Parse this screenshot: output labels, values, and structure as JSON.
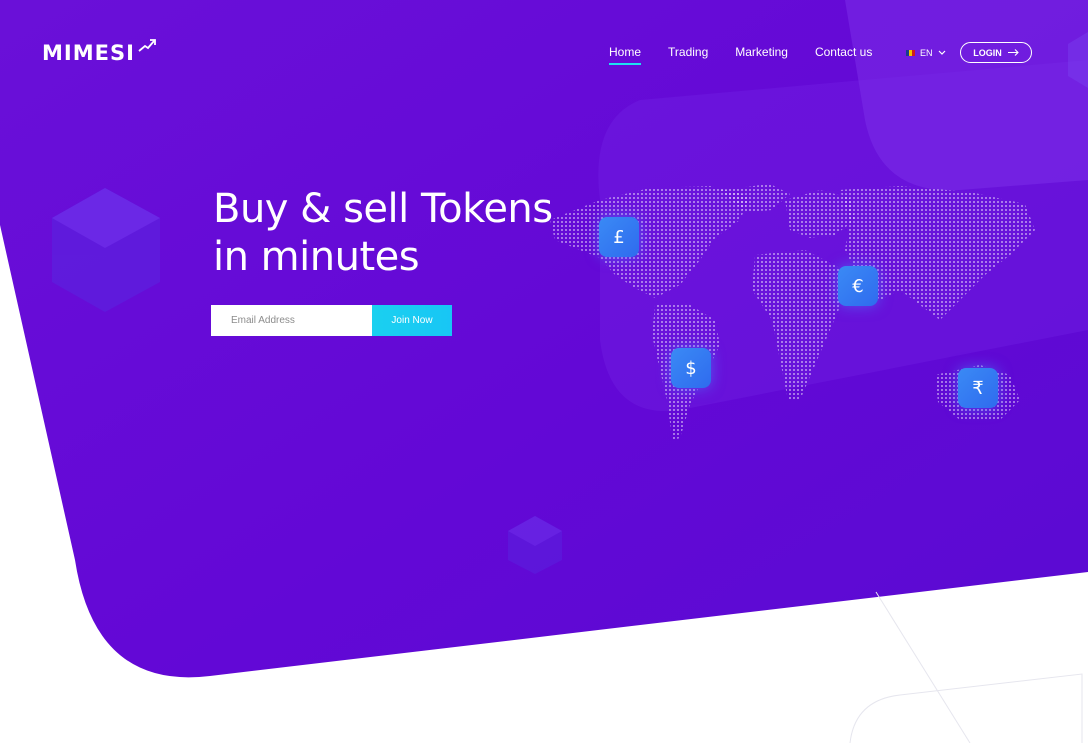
{
  "brand": {
    "logo_text": "MIMESI"
  },
  "nav": {
    "items": [
      {
        "label": "Home",
        "active": true
      },
      {
        "label": "Trading",
        "active": false
      },
      {
        "label": "Marketing",
        "active": false
      },
      {
        "label": "Contact us",
        "active": false
      }
    ]
  },
  "language": {
    "code": "EN"
  },
  "login": {
    "label": "LOGIN"
  },
  "hero": {
    "headline_line1": "Buy & sell Tokens",
    "headline_line2": "in minutes",
    "email_placeholder": "Email Address",
    "join_label": "Join Now"
  },
  "currencies": [
    {
      "symbol": "£",
      "icon": "pound-icon"
    },
    {
      "symbol": "€",
      "icon": "euro-icon"
    },
    {
      "symbol": "$",
      "icon": "dollar-icon"
    },
    {
      "symbol": "₹",
      "icon": "rupee-icon"
    }
  ],
  "colors": {
    "hero_gradient_start": "#6a10d8",
    "hero_gradient_end": "#5a0bd2",
    "accent": "#1ad0f0",
    "currency_tile": "#3a8af5"
  }
}
